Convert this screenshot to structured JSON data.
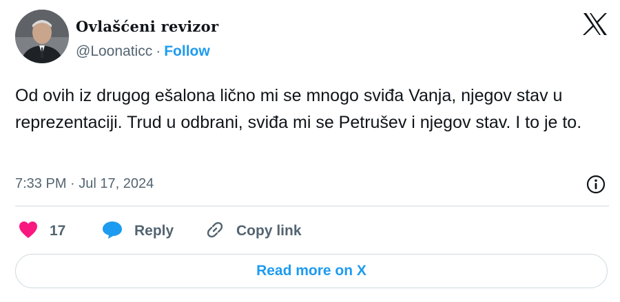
{
  "author": {
    "display_name": "Ovlašćeni revizor",
    "handle": "@Loonaticc",
    "separator": "·",
    "follow_label": "Follow"
  },
  "tweet": {
    "text": "Od ovih iz drugog ešalona lično mi se mnogo sviđa Vanja, njegov stav u reprezentaciji. Trud u odbrani, sviđa mi se Petrušev i njegov stav. I to je to.",
    "time": "7:33 PM",
    "meta_separator": "·",
    "date": "Jul 17, 2024"
  },
  "actions": {
    "like_count": "17",
    "reply_label": "Reply",
    "copy_label": "Copy link"
  },
  "read_more_label": "Read more on X",
  "colors": {
    "accent": "#1d9bf0",
    "like": "#f91880",
    "text": "#0f1419",
    "muted": "#536471",
    "border": "#cfd9de"
  },
  "icons": {
    "logo": "x-logo-icon",
    "info": "info-icon",
    "like": "heart-icon",
    "reply": "speech-bubble-icon",
    "copy": "link-icon"
  }
}
